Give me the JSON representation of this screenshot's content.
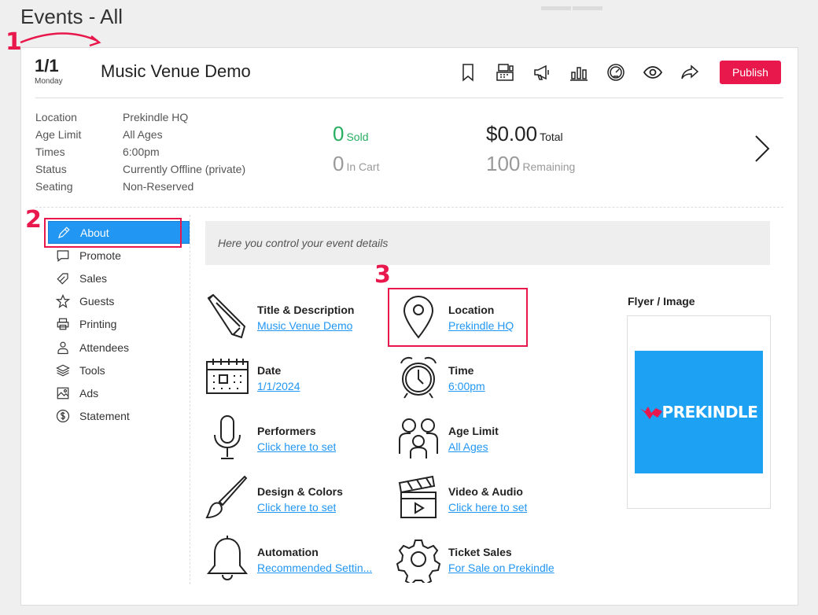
{
  "page": {
    "title": "Events - All"
  },
  "annotations": {
    "step1": "1",
    "step2": "2",
    "step3": "3"
  },
  "event": {
    "date": "1/1",
    "weekday": "Monday",
    "title": "Music Venue Demo",
    "publish_label": "Publish",
    "header_icons": [
      "bookmark-icon",
      "register-icon",
      "megaphone-icon",
      "bar-chart-icon",
      "dashboard-icon",
      "eye-icon",
      "share-icon"
    ]
  },
  "info": [
    {
      "label": "Location",
      "value": "Prekindle HQ"
    },
    {
      "label": "Age Limit",
      "value": "All Ages"
    },
    {
      "label": "Times",
      "value": "6:00pm"
    },
    {
      "label": "Status",
      "value": "Currently Offline (private)"
    },
    {
      "label": "Seating",
      "value": "Non-Reserved"
    }
  ],
  "stats": {
    "sold_value": "0",
    "sold_label": "Sold",
    "cart_value": "0",
    "cart_label": "In Cart",
    "total_value": "$0.00",
    "total_label": "Total",
    "remaining_value": "100",
    "remaining_label": "Remaining"
  },
  "sidebar": {
    "items": [
      {
        "label": "About",
        "icon": "pencil-icon",
        "active": true
      },
      {
        "label": "Promote",
        "icon": "chat-icon"
      },
      {
        "label": "Sales",
        "icon": "tag-icon"
      },
      {
        "label": "Guests",
        "icon": "star-icon"
      },
      {
        "label": "Printing",
        "icon": "printer-icon"
      },
      {
        "label": "Attendees",
        "icon": "person-icon"
      },
      {
        "label": "Tools",
        "icon": "layers-icon"
      },
      {
        "label": "Ads",
        "icon": "image-icon"
      },
      {
        "label": "Statement",
        "icon": "dollar-icon"
      }
    ]
  },
  "notice": "Here you control your event details",
  "tiles": [
    {
      "title": "Title & Description",
      "link": "Music Venue Demo",
      "icon": "pen-icon"
    },
    {
      "title": "Location",
      "link": "Prekindle HQ",
      "icon": "map-pin-icon"
    },
    {
      "title": "Date",
      "link": "1/1/2024",
      "icon": "calendar-icon"
    },
    {
      "title": "Time",
      "link": "6:00pm",
      "icon": "alarm-clock-icon"
    },
    {
      "title": "Performers",
      "link": "Click here to set",
      "icon": "microphone-icon"
    },
    {
      "title": "Age Limit",
      "link": "All Ages",
      "icon": "family-icon"
    },
    {
      "title": "Design & Colors",
      "link": "Click here to set",
      "icon": "paintbrush-icon"
    },
    {
      "title": "Video & Audio",
      "link": "Click here to set",
      "icon": "clapperboard-icon"
    },
    {
      "title": "Automation",
      "link": "Recommended Settin...",
      "icon": "bell-icon"
    },
    {
      "title": "Ticket Sales",
      "link": "For Sale on Prekindle",
      "icon": "gear-icon"
    }
  ],
  "flyer": {
    "label": "Flyer / Image",
    "logo_text": "PREKINDLE"
  },
  "colors": {
    "accent_red": "#e8184c",
    "link_blue": "#2196f3",
    "sold_green": "#27ae60",
    "flyer_blue": "#1da1f2"
  }
}
